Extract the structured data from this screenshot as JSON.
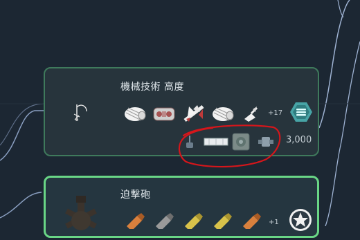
{
  "colors": {
    "background": "#1c2733",
    "node_border_researched": "#3f7a5c",
    "node_border_available": "#69d686",
    "annotation_red": "#d5161b",
    "tech_icon_teal": "#47a4a6"
  },
  "nodes": [
    {
      "title": "機械技術 高度",
      "extra_count": "+17",
      "cost": "3,000",
      "main_icon": "grapple-hook-icon",
      "unlock_icons": [
        "gatling-icon",
        "gun-pod-icon",
        "winged-missile-icon",
        "gatling-icon",
        "cannon-turret-icon"
      ],
      "secondary_icons": [
        "antenna-icon",
        "rail-segment-icon",
        "floor-tile-icon",
        "connector-icon"
      ],
      "tech_badge_icon": "hexagon-tech-icon"
    },
    {
      "title": "迫撃砲",
      "extra_count": "+1",
      "main_icon": "mortar-icon",
      "unlock_icons": [
        "shell-bronze-icon",
        "shell-silver-icon",
        "shell-gold-icon",
        "shell-gold-icon",
        "shell-bronze-icon"
      ],
      "tech_badge_icon": "star-icon"
    }
  ]
}
